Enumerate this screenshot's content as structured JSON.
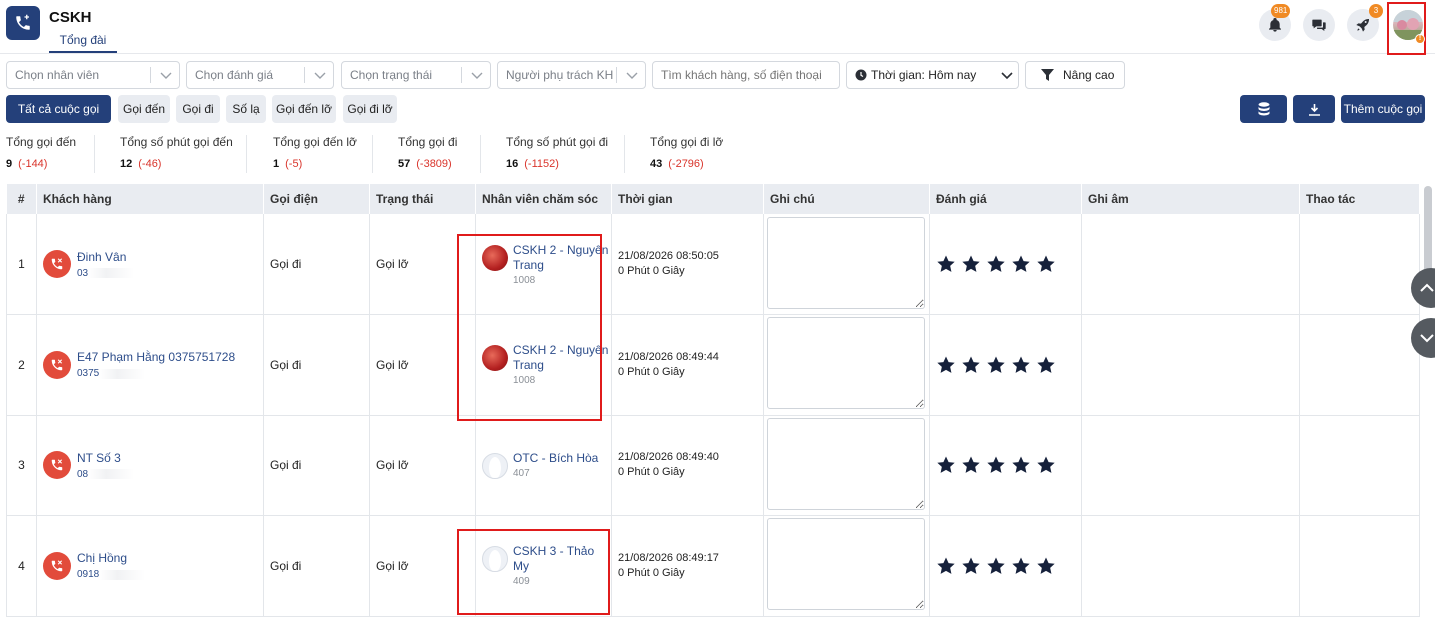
{
  "header": {
    "app_title": "CSKH",
    "tab": "Tổng đài",
    "notification_count": "981",
    "rocket_count": "3",
    "avatar_alert": "!"
  },
  "filters": {
    "staff": "Chọn nhân viên",
    "rating": "Chọn đánh giá",
    "status": "Chọn trạng thái",
    "owner": "Người phụ trách KH",
    "search_placeholder": "Tìm khách hàng, số điện thoại",
    "time": "Thời gian: Hôm nay",
    "advanced": "Nâng cao"
  },
  "quick_tabs": [
    "Tất cả cuộc gọi",
    "Gọi đến",
    "Gọi đi",
    "Số lạ",
    "Gọi đến lỡ",
    "Gọi đi lỡ"
  ],
  "actions": {
    "add_call": "Thêm cuộc gọi"
  },
  "stats": [
    {
      "label": "Tổng gọi đến",
      "value": "9",
      "delta": "(-144)"
    },
    {
      "label": "Tổng số phút gọi đến",
      "value": "12",
      "delta": "(-46)"
    },
    {
      "label": "Tổng gọi đến lỡ",
      "value": "1",
      "delta": "(-5)"
    },
    {
      "label": "Tổng gọi đi",
      "value": "57",
      "delta": "(-3809)"
    },
    {
      "label": "Tổng số phút gọi đi",
      "value": "16",
      "delta": "(-1152)"
    },
    {
      "label": "Tổng gọi đi lỡ",
      "value": "43",
      "delta": "(-2796)"
    }
  ],
  "table": {
    "columns": [
      "#",
      "Khách hàng",
      "Gọi điện",
      "Trạng thái",
      "Nhân viên chăm sóc",
      "Thời gian",
      "Ghi chú",
      "Đánh giá",
      "Ghi âm",
      "Thao tác"
    ],
    "rows": [
      {
        "index": "1",
        "customer": "Đinh Vân",
        "phone": "03",
        "call_type": "Gọi đi",
        "status": "Gọi lỡ",
        "staff": "CSKH 2 - Nguyên Trang",
        "ext": "1008",
        "datetime": "21/08/2026 08:50:05",
        "duration": "0 Phút 0 Giây"
      },
      {
        "index": "2",
        "customer": "E47 Phạm Hằng 0375751728",
        "phone": "0375",
        "call_type": "Gọi đi",
        "status": "Gọi lỡ",
        "staff": "CSKH 2 - Nguyên Trang",
        "ext": "1008",
        "datetime": "21/08/2026 08:49:44",
        "duration": "0 Phút 0 Giây"
      },
      {
        "index": "3",
        "customer": "NT Số 3",
        "phone": "08",
        "call_type": "Gọi đi",
        "status": "Gọi lỡ",
        "staff": "OTC - Bích Hòa",
        "ext": "407",
        "datetime": "21/08/2026 08:49:40",
        "duration": "0 Phút 0 Giây"
      },
      {
        "index": "4",
        "customer": "Chị Hồng",
        "phone": "0918",
        "call_type": "Gọi đi",
        "status": "Gọi lỡ",
        "staff": "CSKH 3 - Thảo My",
        "ext": "409",
        "datetime": "21/08/2026 08:49:17",
        "duration": "0 Phút 0 Giây"
      }
    ]
  },
  "colors": {
    "primary": "#24407a",
    "missed_call": "#e24b3b",
    "negative_delta": "#d9342b",
    "highlight_box": "#e01b1b",
    "badge": "#f08a24"
  }
}
